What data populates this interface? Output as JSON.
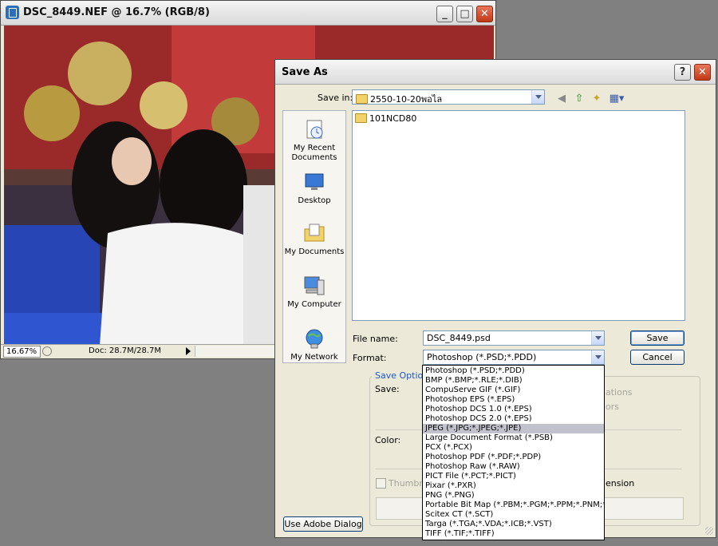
{
  "docwindow": {
    "title": "DSC_8449.NEF @ 16.7% (RGB/8)",
    "zoom": "16.67%",
    "doc_info": "Doc: 28.7M/28.7M"
  },
  "dialog": {
    "title": "Save As",
    "save_in_label": "Save in:",
    "save_in_value": "2550-10-20พอไล",
    "places": [
      {
        "label": "My Recent Documents",
        "icon": "recent-documents-icon"
      },
      {
        "label": "Desktop",
        "icon": "desktop-icon"
      },
      {
        "label": "My Documents",
        "icon": "my-documents-icon"
      },
      {
        "label": "My Computer",
        "icon": "my-computer-icon"
      },
      {
        "label": "My Network",
        "icon": "my-network-icon"
      }
    ],
    "files": [
      "101NCD80"
    ],
    "file_name_label": "File name:",
    "file_name_value": "DSC_8449.psd",
    "format_label": "Format:",
    "format_value": "Photoshop (*.PSD;*.PDD)",
    "save_button": "Save",
    "cancel_button": "Cancel",
    "save_options_title": "Save Options",
    "save_label": "Save:",
    "color_label": "Color:",
    "partial_ations": "ations",
    "partial_ors": "ors",
    "thumbnail_label": "Thumbnail",
    "extension_label": "ension",
    "adobe_dialog_button": "Use Adobe Dialog"
  },
  "format_options": [
    "Photoshop (*.PSD;*.PDD)",
    "BMP (*.BMP;*.RLE;*.DIB)",
    "CompuServe GIF (*.GIF)",
    "Photoshop EPS (*.EPS)",
    "Photoshop DCS 1.0 (*.EPS)",
    "Photoshop DCS 2.0 (*.EPS)",
    "JPEG (*.JPG;*.JPEG;*.JPE)",
    "Large Document Format (*.PSB)",
    "PCX (*.PCX)",
    "Photoshop PDF (*.PDF;*.PDP)",
    "Photoshop Raw (*.RAW)",
    "PICT File (*.PCT;*.PICT)",
    "Pixar (*.PXR)",
    "PNG (*.PNG)",
    "Portable Bit Map (*.PBM;*.PGM;*.PPM;*.PNM;*.PFM",
    "Scitex CT (*.SCT)",
    "Targa (*.TGA;*.VDA;*.ICB;*.VST)",
    "TIFF (*.TIF;*.TIFF)"
  ],
  "selected_format_index": 6,
  "colors": {
    "selection": "#c2c2cc",
    "group_title": "#1a58d6",
    "close_button": "#c03a17"
  }
}
